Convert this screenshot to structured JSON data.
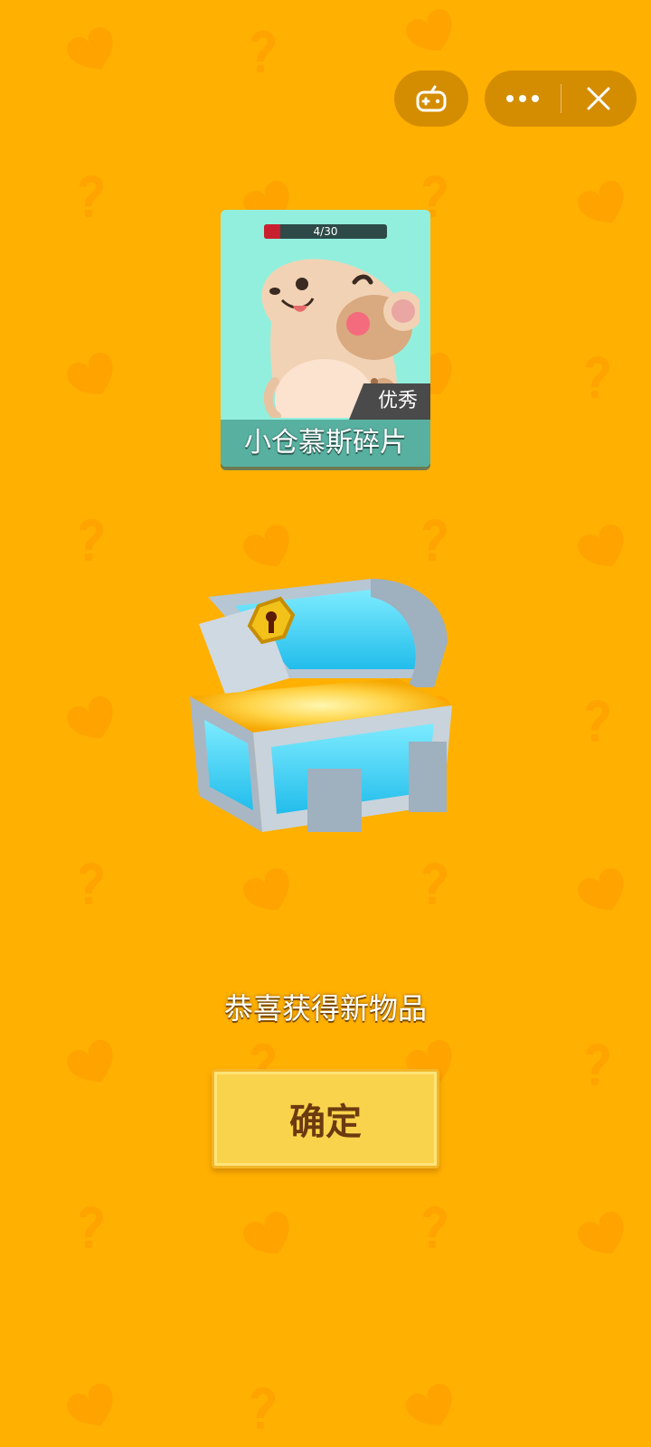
{
  "colors": {
    "background": "#FFB000",
    "card_bg": "#93EFDD",
    "card_name_bar": "#58B1A0",
    "progress_fill": "#C8202E",
    "button": "#FAD34C",
    "button_text": "#6B3A10"
  },
  "top_bar": {
    "game_icon": "gamepad-icon",
    "more_icon": "more-dots-icon",
    "close_icon": "close-icon"
  },
  "item_card": {
    "progress_text": "4/30",
    "progress_current": 4,
    "progress_total": 30,
    "rarity": "优秀",
    "name": "小仓慕斯碎片"
  },
  "reward": {
    "message": "恭喜获得新物品",
    "confirm_label": "确定"
  }
}
